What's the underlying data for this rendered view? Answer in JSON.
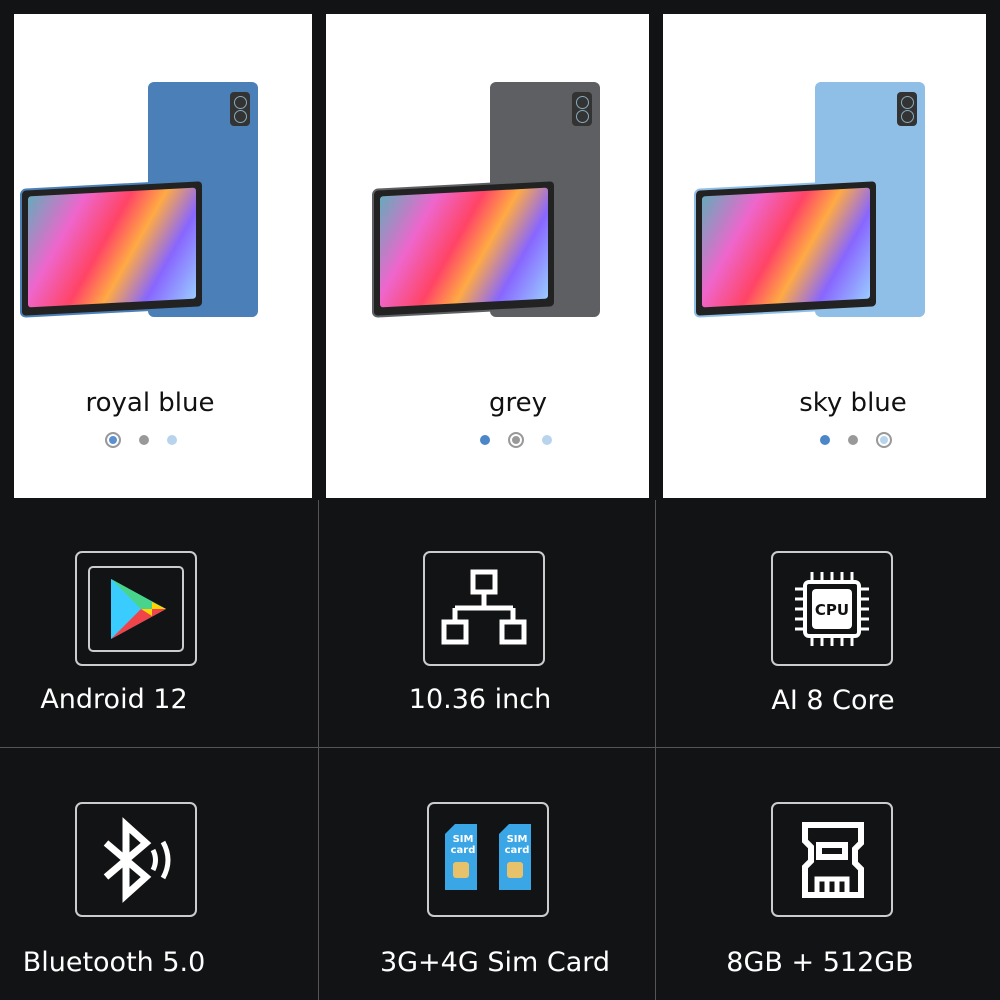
{
  "colors": [
    {
      "label": "royal blue",
      "color": "#4a7fb8",
      "dots": [
        "#5b8fd0",
        "#999999",
        "#b8d4ec"
      ],
      "selected": 0
    },
    {
      "label": "grey",
      "color": "#5d5f62",
      "dots": [
        "#4a86c8",
        "#999999",
        "#b8d4ec"
      ],
      "selected": 1
    },
    {
      "label": "sky blue",
      "color": "#8fbfe6",
      "dots": [
        "#4a86c8",
        "#999999",
        "#b8d4ec"
      ],
      "selected": 2
    }
  ],
  "features": [
    {
      "label": "Android 12",
      "icon": "play-store-icon"
    },
    {
      "label": "10.36 inch",
      "icon": "network-icon"
    },
    {
      "label": "AI 8 Core",
      "icon": "cpu-icon",
      "icon_text": "CPU"
    },
    {
      "label": "Bluetooth 5.0",
      "icon": "bluetooth-icon"
    },
    {
      "label": "3G+4G Sim Card",
      "icon": "sim-card-icon",
      "icon_text": "SIM card"
    },
    {
      "label": "8GB + 512GB",
      "icon": "memory-card-icon"
    }
  ]
}
